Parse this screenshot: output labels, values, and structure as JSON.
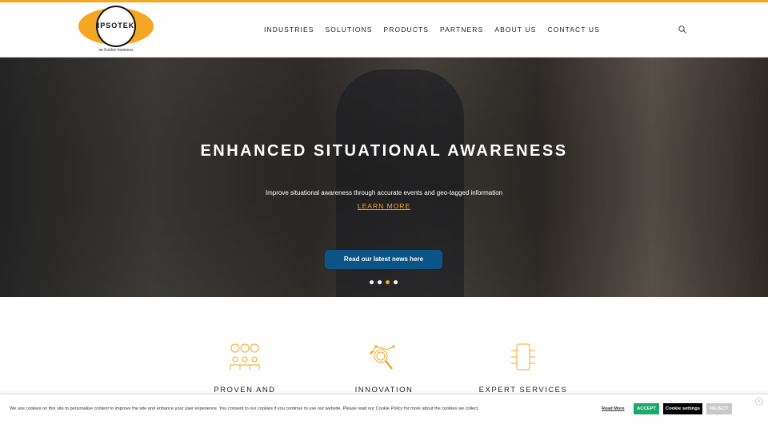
{
  "header": {
    "logo_text": "IPSOTEK",
    "logo_sub": "an Eviden business",
    "nav": [
      "INDUSTRIES",
      "SOLUTIONS",
      "PRODUCTS",
      "PARTNERS",
      "ABOUT US",
      "CONTACT US"
    ]
  },
  "hero": {
    "title": "ENHANCED SITUATIONAL AWARENESS",
    "description": "Improve situational awareness through accurate events and geo-tagged information",
    "learn_more": "LEARN MORE",
    "news_button": "Read our latest news here",
    "active_slide": 3,
    "slide_count": 4
  },
  "features": [
    {
      "title": "PROVEN AND"
    },
    {
      "title": "INNOVATION"
    },
    {
      "title": "EXPERT SERVICES"
    }
  ],
  "cookie": {
    "message": "We use cookies on this site to personalise content to improve the site and enhance your user experience. You consent to our cookies if you continue to use our website. Please read our Cookie Policy for more about the cookies we collect.",
    "read_more": "Read More",
    "accept": "ACCEPT",
    "settings": "Cookie settings",
    "reject": "REJECT",
    "close": "x"
  },
  "colors": {
    "accent": "#f5a623",
    "news_button": "#0b5487",
    "accept": "#1aa86b"
  }
}
